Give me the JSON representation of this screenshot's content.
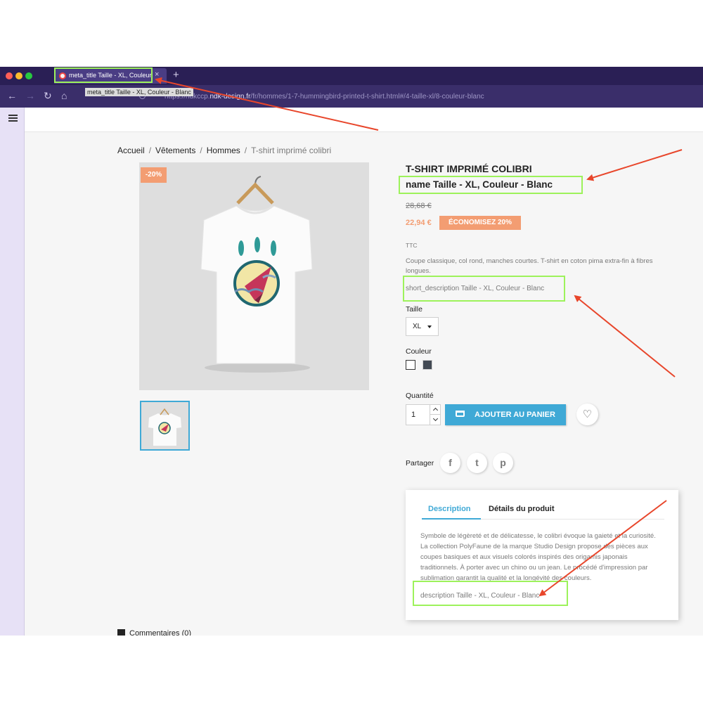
{
  "browser": {
    "tab_title": "meta_title Taille - XL, Couleur",
    "tab_close": "×",
    "new_tab": "+",
    "tooltip": "meta_title Taille - XL, Couleur - Blanc",
    "url_prefix": "https://ndkccp.",
    "url_domain": "ndk-design.fr",
    "url_path": "/fr/hommes/1-7-hummingbird-printed-t-shirt.html#/4-taille-xl/8-couleur-blanc"
  },
  "breadcrumb": [
    "Accueil",
    "Vêtements",
    "Hommes",
    "T-shirt imprimé colibri"
  ],
  "breadcrumb_sep": "/",
  "product": {
    "badge": "-20%",
    "title": "T-SHIRT IMPRIMÉ COLIBRI",
    "name": "name Taille - XL, Couleur - Blanc",
    "old_price": "28,68 €",
    "new_price": "22,94 €",
    "discount": "ÉCONOMISEZ 20%",
    "tax": "TTC",
    "summary": "Coupe classique, col rond, manches courtes. T-shirt en coton pima extra-fin à fibres longues.",
    "short_description": "short_description Taille - XL, Couleur - Blanc",
    "size_label": "Taille",
    "size_value": "XL",
    "color_label": "Couleur",
    "colors": [
      "#ffffff",
      "#434a54"
    ],
    "qty_label": "Quantité",
    "qty_value": "1",
    "add_to_cart": "AJOUTER AU PANIER",
    "share_label": "Partager",
    "share_icons": [
      "facebook-icon",
      "twitter-icon",
      "pinterest-icon"
    ]
  },
  "tabs": {
    "description_tab": "Description",
    "details_tab": "Détails du produit",
    "long_description": "Symbole de légèreté et de délicatesse, le colibri évoque la gaieté et la curiosité. La collection PolyFaune de la marque Studio Design propose des pièces aux coupes basiques et aux visuels colorés inspirés des origamis japonais traditionnels. À porter avec un chino ou un jean. Le procédé d'impression par sublimation garantit la qualité et la longévité des couleurs.",
    "description_field": "description Taille - XL, Couleur - Blanc"
  },
  "comments": "Commentaires (0)",
  "colors": {
    "accent": "#3fa9d6",
    "sale": "#f39d72",
    "highlight": "#9df25b",
    "arrow": "#e8462b"
  }
}
